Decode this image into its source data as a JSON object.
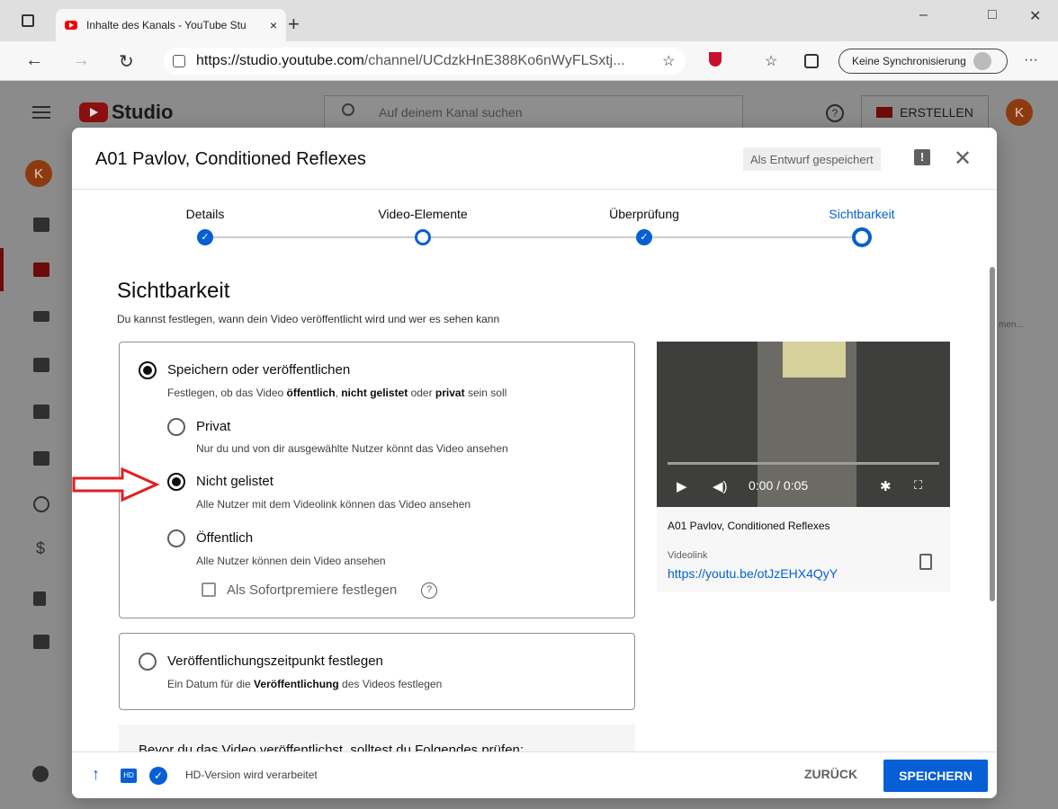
{
  "browser": {
    "tab_title": "Inhalte des Kanals - YouTube Stu",
    "tab_close": "×",
    "new_tab": "+",
    "url_host": "https://studio.youtube.com",
    "url_path": "/channel/UCdzkHnE388Ko6nWyFLSxtj...",
    "sync_label": "Keine Synchronisierung",
    "more": "···",
    "window": {
      "minimize": "–",
      "maximize": "□",
      "close": "✕"
    },
    "nav": {
      "back": "←",
      "forward": "→",
      "reload": "↻"
    }
  },
  "studio": {
    "logo_text": "Studio",
    "search_placeholder": "Auf deinem Kanal suchen",
    "help": "?",
    "create_label": "ERSTELLEN",
    "avatar_letter": "K",
    "behind_text": "men..."
  },
  "modal": {
    "title": "A01 Pavlov, Conditioned Reflexes",
    "draft_badge": "Als Entwurf gespeichert",
    "feedback": "!",
    "close": "✕",
    "steps": [
      {
        "label": "Details",
        "state": "done"
      },
      {
        "label": "Video-Elemente",
        "state": "open"
      },
      {
        "label": "Überprüfung",
        "state": "done"
      },
      {
        "label": "Sichtbarkeit",
        "state": "current"
      }
    ],
    "section_title": "Sichtbarkeit",
    "section_subtitle": "Du kannst festlegen, wann dein Video veröffentlicht wird und wer es sehen kann",
    "save_publish": {
      "label": "Speichern oder veröffentlichen",
      "desc_pre": "Festlegen, ob das Video ",
      "desc_b1": "öffentlich",
      "desc_mid1": ", ",
      "desc_b2": "nicht gelistet",
      "desc_mid2": " oder ",
      "desc_b3": "privat",
      "desc_post": " sein soll",
      "selected": true
    },
    "options": [
      {
        "label": "Privat",
        "desc": "Nur du und von dir ausgewählte Nutzer könnt das Video ansehen",
        "selected": false
      },
      {
        "label": "Nicht gelistet",
        "desc": "Alle Nutzer mit dem Videolink können das Video ansehen",
        "selected": true
      },
      {
        "label": "Öffentlich",
        "desc": "Alle Nutzer können dein Video ansehen",
        "selected": false
      }
    ],
    "premiere_label": "Als Sofortpremiere festlegen",
    "premiere_help": "?",
    "schedule": {
      "label": "Veröffentlichungszeitpunkt festlegen",
      "desc_pre": "Ein Datum für die ",
      "desc_b": "Veröffentlichung",
      "desc_post": " des Videos festlegen"
    },
    "check_note": "Bevor du das Video veröffentlichst, solltest du Folgendes prüfen:",
    "video": {
      "time": "0:00 / 0:05",
      "title": "A01 Pavlov, Conditioned Reflexes",
      "link_label": "Videolink",
      "link": "https://youtu.be/otJzEHX4QyY"
    },
    "footer": {
      "status": "HD-Version wird verarbeitet",
      "hd_badge": "HD",
      "back": "ZURÜCK",
      "save": "SPEICHERN"
    }
  },
  "colors": {
    "accent": "#065fd4",
    "annotation_arrow": "#e02020"
  }
}
